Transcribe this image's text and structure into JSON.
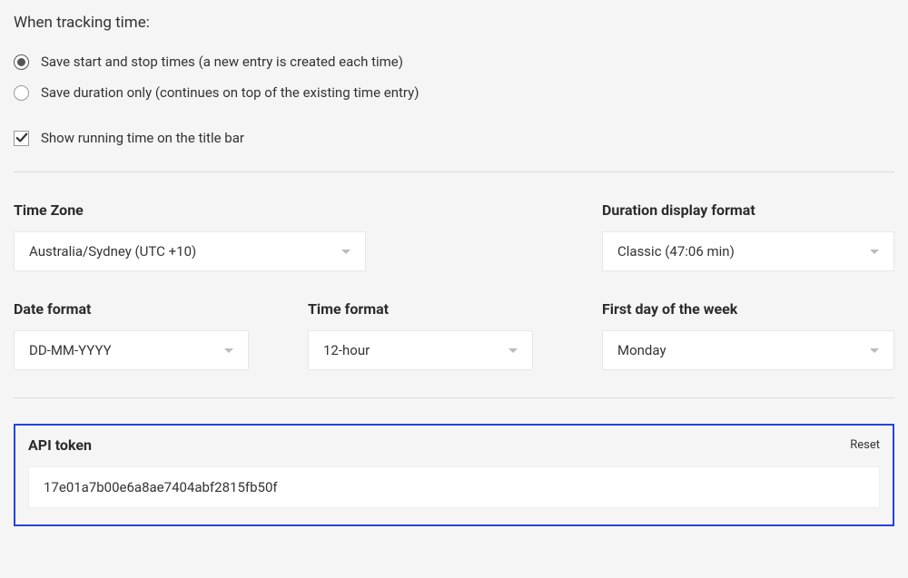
{
  "tracking": {
    "heading": "When tracking time:",
    "option_start_stop": "Save start and stop times (a new entry is created each time)",
    "option_duration": "Save duration only (continues on top of the existing time entry)",
    "show_running_label": "Show running time on the title bar"
  },
  "timezone": {
    "label": "Time Zone",
    "value": "Australia/Sydney (UTC +10)"
  },
  "duration_format": {
    "label": "Duration display format",
    "value": "Classic (47:06 min)"
  },
  "date_format": {
    "label": "Date format",
    "value": "DD-MM-YYYY"
  },
  "time_format": {
    "label": "Time format",
    "value": "12-hour"
  },
  "first_day": {
    "label": "First day of the week",
    "value": "Monday"
  },
  "api": {
    "label": "API token",
    "reset": "Reset",
    "value": "17e01a7b00e6a8ae7404abf2815fb50f"
  }
}
